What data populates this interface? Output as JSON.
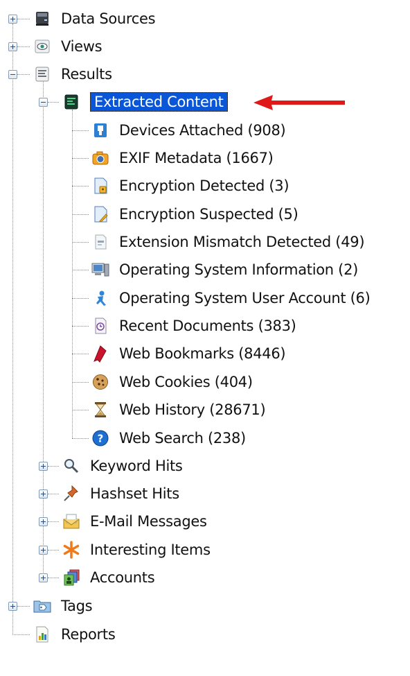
{
  "tree": {
    "data_sources": "Data Sources",
    "views": "Views",
    "results": "Results",
    "extracted_content": "Extracted Content",
    "children": [
      "Devices Attached (908)",
      "EXIF Metadata (1667)",
      "Encryption Detected (3)",
      "Encryption Suspected (5)",
      "Extension Mismatch Detected (49)",
      "Operating System Information (2)",
      "Operating System User Account (6)",
      "Recent Documents (383)",
      "Web Bookmarks (8446)",
      "Web Cookies (404)",
      "Web History (28671)",
      "Web Search (238)"
    ],
    "keyword_hits": "Keyword Hits",
    "hashset_hits": "Hashset Hits",
    "email_messages": "E-Mail Messages",
    "interesting_items": "Interesting Items",
    "accounts": "Accounts",
    "tags": "Tags",
    "reports": "Reports"
  },
  "icons": [
    "data-sources-icon",
    "views-icon",
    "results-icon",
    "extracted-content-icon",
    "usb-device-icon",
    "camera-icon",
    "encrypted-file-icon",
    "encrypted-file-suspected-icon",
    "mismatch-file-icon",
    "computer-icon",
    "user-account-icon",
    "recent-document-icon",
    "bookmark-icon",
    "cookie-icon",
    "hourglass-icon",
    "web-search-icon",
    "magnifier-icon",
    "pushpin-icon",
    "envelope-icon",
    "asterisk-icon",
    "accounts-icon",
    "tag-folder-icon",
    "report-icon"
  ],
  "colors": {
    "selection": "#0a56d8",
    "arrow": "#e01818"
  }
}
